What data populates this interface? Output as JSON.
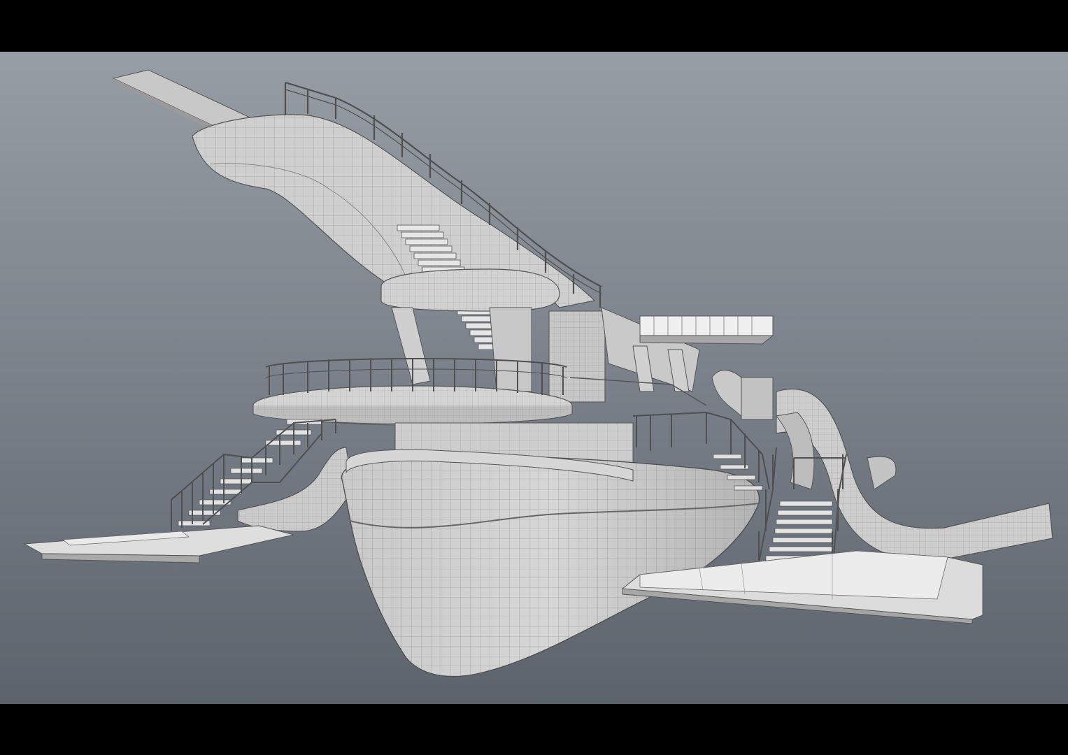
{
  "scene": {
    "subject": "playground-ship-wireframe-model",
    "colors": {
      "letterbox": "#000000",
      "background_top": "#979da4",
      "background_bottom": "#5c636c",
      "surface": "#d9d9d9",
      "surface_shadow": "#a9a9a9",
      "wire": "#6f6f6f"
    }
  }
}
